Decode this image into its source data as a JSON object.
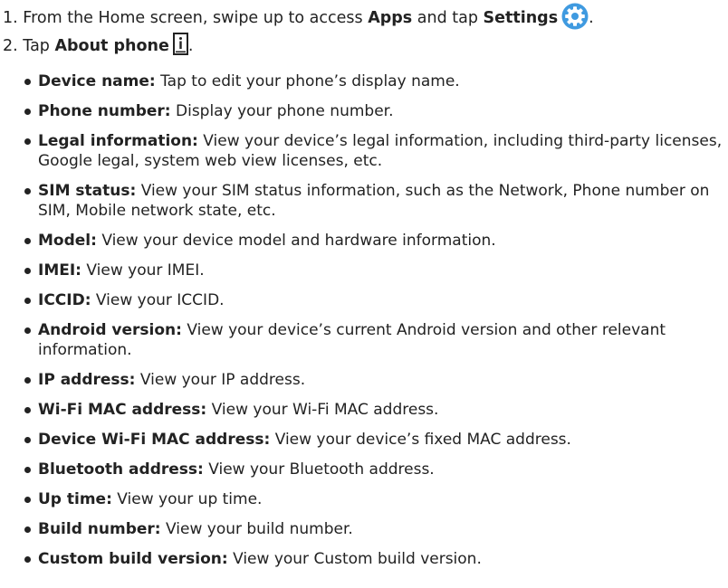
{
  "step1": {
    "number": "1.",
    "text_a": "From the Home screen, swipe up to access ",
    "apps": "Apps",
    "text_b": " and tap ",
    "settings": "Settings",
    "icon": "settings-gear-icon",
    "icon_color": "#3f9ae0",
    "tail": "."
  },
  "step2": {
    "number": "2.",
    "text_a": "Tap ",
    "about": "About phone",
    "icon": "about-phone-info-icon",
    "tail": "."
  },
  "items": [
    {
      "term": "Device name:",
      "desc": "Tap to edit your phone’s display name."
    },
    {
      "term": "Phone number:",
      "desc": "Display your phone number."
    },
    {
      "term": "Legal information:",
      "desc": "View your device’s legal information, including third-party licenses, Google legal, system web view licenses, etc."
    },
    {
      "term": "SIM status:",
      "desc": "View your SIM status information, such as the Network, Phone number on SIM, Mobile network state, etc."
    },
    {
      "term": "Model:",
      "desc": "View your device model and hardware information."
    },
    {
      "term": "IMEI:",
      "desc": "View your IMEI."
    },
    {
      "term": "ICCID:",
      "desc": "View your ICCID."
    },
    {
      "term": "Android version:",
      "desc": "View your device’s current Android version and other relevant information."
    },
    {
      "term": "IP address:",
      "desc": "View your IP address."
    },
    {
      "term": "Wi-Fi MAC address:",
      "desc": "View your Wi-Fi MAC address."
    },
    {
      "term": "Device Wi-Fi MAC address:",
      "desc": "View your device’s fixed MAC address."
    },
    {
      "term": "Bluetooth address:",
      "desc": "View your Bluetooth address."
    },
    {
      "term": "Up time:",
      "desc": "View your up time."
    },
    {
      "term": "Build number:",
      "desc": "View your build number."
    },
    {
      "term": "Custom build version:",
      "desc": "View your Custom build version."
    }
  ]
}
